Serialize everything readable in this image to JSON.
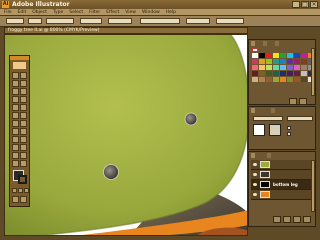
{
  "window": {
    "title": "Adobe Illustrator",
    "app_icon": "Ai"
  },
  "menu": [
    "File",
    "Edit",
    "Object",
    "Type",
    "Select",
    "Filter",
    "Effect",
    "View",
    "Window",
    "Help"
  ],
  "document": {
    "tab_title": "froggy tree II.ai @ 800% (CMYK/Preview)"
  },
  "layers_panel": {
    "layer_name": "bottom leg"
  },
  "colors": {
    "chrome": "#6d5228",
    "frog_green": "#9bab3e",
    "orange": "#e8851e",
    "panel_bg": "#6e5632"
  },
  "icons": [
    "minimize-icon",
    "maximize-icon",
    "close-icon",
    "eye-icon",
    "trash-icon",
    "new-layer-icon"
  ]
}
